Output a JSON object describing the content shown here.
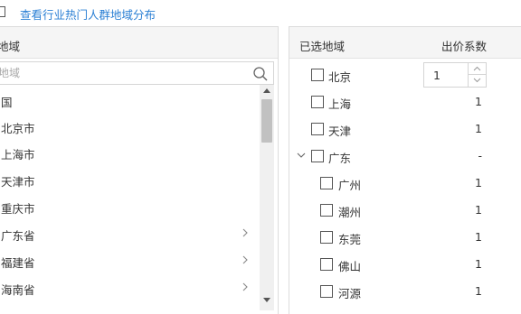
{
  "top": {
    "link_text": "查看行业热门人群地域分布"
  },
  "left": {
    "header": "地域",
    "search_placeholder": "地域",
    "regions": [
      {
        "label": "国",
        "has_children": false
      },
      {
        "label": "北京市",
        "has_children": false
      },
      {
        "label": "上海市",
        "has_children": false
      },
      {
        "label": "天津市",
        "has_children": false
      },
      {
        "label": "重庆市",
        "has_children": false
      },
      {
        "label": "广东省",
        "has_children": true
      },
      {
        "label": "福建省",
        "has_children": true
      },
      {
        "label": "海南省",
        "has_children": true
      }
    ]
  },
  "right": {
    "header_title": "已选地域",
    "header_coef": "出价系数",
    "selected": [
      {
        "name": "北京",
        "coef": "1",
        "level": 0,
        "stepper": true
      },
      {
        "name": "上海",
        "coef": "1",
        "level": 0
      },
      {
        "name": "天津",
        "coef": "1",
        "level": 0
      },
      {
        "name": "广东",
        "coef": "-",
        "level": 0,
        "expandable": true
      },
      {
        "name": "广州",
        "coef": "1",
        "level": 1
      },
      {
        "name": "潮州",
        "coef": "1",
        "level": 1
      },
      {
        "name": "东莞",
        "coef": "1",
        "level": 1
      },
      {
        "name": "佛山",
        "coef": "1",
        "level": 1
      },
      {
        "name": "河源",
        "coef": "1",
        "level": 1
      }
    ]
  },
  "colors": {
    "link": "#2a7fd4",
    "header_bg": "#f5f5f5",
    "border": "#dcdcdc",
    "scroll_thumb": "#c1c1c1"
  }
}
